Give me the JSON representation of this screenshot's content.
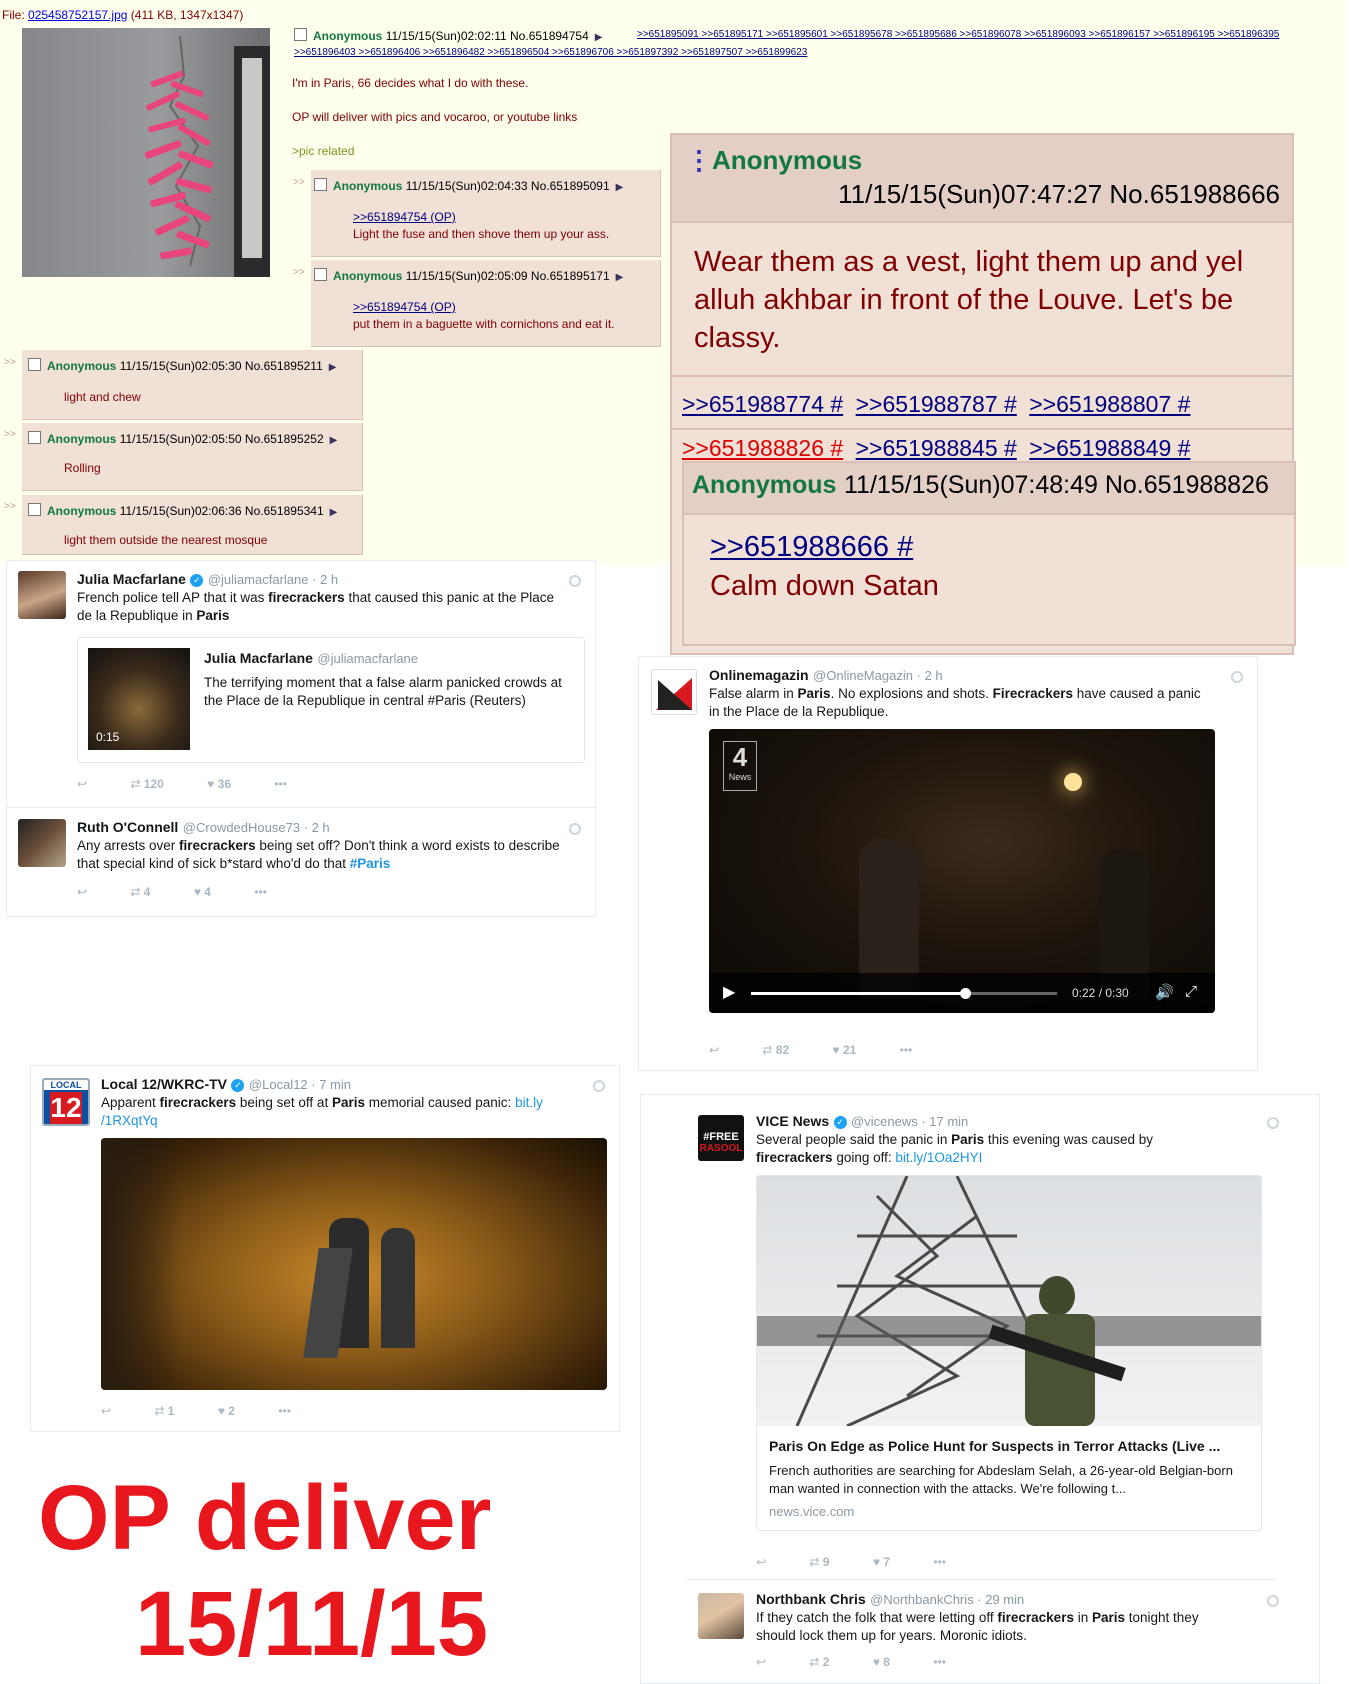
{
  "op": {
    "file_label": "File:",
    "file_name": "025458752157.jpg",
    "file_info": "(411 KB, 1347x1347)",
    "name": "Anonymous",
    "date": "11/15/15(Sun)02:02:11",
    "no": "No.651894754",
    "backlinks_line1": ">>651895091 >>651895171 >>651895601 >>651895678 >>651895686 >>651896078 >>651896093 >>651896157 >>651896195 >>651896395",
    "backlinks_line2": ">>651896403 >>651896406 >>651896482 >>651896504 >>651896706 >>651897392 >>651897507 >>651899623",
    "text1": "I'm in Paris, 66 decides what I do with these.",
    "text2": "OP will deliver with pics and vocaroo, or youtube links",
    "text3": ">pic related"
  },
  "replies": [
    {
      "arrows": ">>",
      "name": "Anonymous",
      "date": "11/15/15(Sun)02:04:33",
      "no": "No.651895091",
      "quote": ">>651894754 (OP)",
      "text": "Light the fuse and then shove them up your ass."
    },
    {
      "arrows": ">>",
      "name": "Anonymous",
      "date": "11/15/15(Sun)02:05:09",
      "no": "No.651895171",
      "quote": ">>651894754 (OP)",
      "text": "put them in a baguette with cornichons and eat it."
    },
    {
      "arrows": ">>",
      "name": "Anonymous",
      "date": "11/15/15(Sun)02:05:30",
      "no": "No.651895211",
      "text": "light and chew"
    },
    {
      "arrows": ">>",
      "name": "Anonymous",
      "date": "11/15/15(Sun)02:05:50",
      "no": "No.651895252",
      "text": "Rolling"
    },
    {
      "arrows": ">>",
      "name": "Anonymous",
      "date": "11/15/15(Sun)02:06:36",
      "no": "No.651895341",
      "text": "light them outside the nearest mosque"
    }
  ],
  "bigpost": {
    "menu": "⋮",
    "name": "Anonymous",
    "datetime": "11/15/15(Sun)07:47:27 No.651988666",
    "text": "Wear them as a vest, light them up and yel alluh akhbar in front of the Louve. Let's be classy.",
    "refs_row1": [
      ">>651988774 #",
      ">>651988787 #",
      ">>651988807 #"
    ],
    "refs_row2": [
      ">>651988826 #",
      ">>651988845 #",
      ">>651988849 #"
    ],
    "inner_name": "Anonymous",
    "inner_datetime": "11/15/15(Sun)07:48:49 No.651988826",
    "inner_quote": ">>651988666 #",
    "inner_text": "Calm down Satan"
  },
  "tweets": {
    "julia": {
      "name": "Julia Macfarlane",
      "handle": "@juliamacfarlane · 2 h",
      "text_a": "French police tell AP that it was ",
      "text_b": "firecrackers",
      "text_c": " that caused this panic at the Place de la Republique in ",
      "text_d": "Paris",
      "quoted_name": "Julia Macfarlane",
      "quoted_handle": "@juliamacfarlane",
      "quoted_text": "The terrifying moment that a false alarm panicked crowds at the Place de la Republique in central #Paris (Reuters)",
      "video_time": "0:15",
      "retweets": "120",
      "likes": "36",
      "more": "•••"
    },
    "ruth": {
      "name": "Ruth O'Connell",
      "handle": "@CrowdedHouse73 · 2 h",
      "text_a": "Any arrests over ",
      "text_b": "firecrackers",
      "text_c": " being set off?  Don't think a word exists to describe that special kind of sick b*stard who'd do that ",
      "text_d": "#Paris",
      "retweets": "4",
      "likes": "4",
      "more": "•••"
    },
    "online": {
      "name": "Onlinemagazin",
      "handle": "@OnlineMagazin · 2 h",
      "text_a": "False alarm in ",
      "text_b": "Paris",
      "text_c": ". No explosions and shots. ",
      "text_d": "Firecrackers",
      "text_e": " have caused a panic in the Place de la Republique.",
      "channel": "4",
      "channel_sub": "News",
      "player_time": "0:22 / 0:30",
      "progress": 0.7,
      "retweets": "82",
      "likes": "21",
      "more": "•••"
    },
    "local12": {
      "name": "Local 12/WKRC-TV",
      "handle": "@Local12 · 7 min",
      "logo_top": "LOCAL",
      "logo_num": "12",
      "text_a": "Apparent ",
      "text_b": "firecrackers",
      "text_c": " being set off at ",
      "text_d": "Paris",
      "text_e": " memorial caused panic: ",
      "link": "bit.ly /1RXqtYq",
      "retweets": "1",
      "likes": "2",
      "more": "•••"
    },
    "vice": {
      "name": "VICE News",
      "handle": "@vicenews · 17 min",
      "avatar_text1": "#FREE",
      "avatar_text2": "RASOOL",
      "text_a": "Several people said the panic in ",
      "text_b": "Paris",
      "text_c": " this evening was caused by ",
      "text_d": "firecrackers",
      "text_e": " going off: ",
      "link": "bit.ly/1Oa2HYI",
      "card_title": "Paris On Edge as Police Hunt for Suspects in Terror Attacks (Live ...",
      "card_desc": "French authorities are searching for Abdeslam Selah, a 26-year-old Belgian-born man wanted in connection with the attacks. We're following t...",
      "card_domain": "news.vice.com",
      "retweets": "9",
      "likes": "7",
      "more": "•••"
    },
    "chris": {
      "name": "Northbank Chris",
      "handle": "@NorthbankChris · 29 min",
      "text_a": "If they catch the folk that were letting off ",
      "text_b": "firecrackers",
      "text_c": " in ",
      "text_d": "Paris",
      "text_e": " tonight they should lock them up for years. Moronic idiots.",
      "retweets": "2",
      "likes": "8",
      "more": "•••"
    }
  },
  "caption": {
    "line1": "OP deliver",
    "line2": "15/11/15",
    "color": "#e8161d"
  },
  "icons": [
    "reply-icon",
    "retweet-icon",
    "heart-icon",
    "more-icon",
    "gear-icon",
    "verified-icon",
    "play-icon",
    "volume-icon",
    "fullscreen-icon"
  ]
}
